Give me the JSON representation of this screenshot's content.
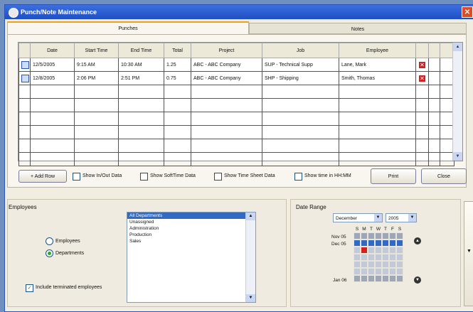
{
  "window": {
    "title": "Punch/Note Maintenance"
  },
  "tabs": [
    {
      "label": "Punches"
    },
    {
      "label": "Notes"
    }
  ],
  "grid": {
    "columns": [
      "Date",
      "Start Time",
      "End Time",
      "Total",
      "Project",
      "Job",
      "Employee"
    ],
    "rows": [
      {
        "date": "12/5/2005",
        "start": "9:15 AM",
        "end": "10:30 AM",
        "total": "1.25",
        "project": "ABC - ABC Company",
        "job": "SUP - Technical Supp",
        "employee": "Lane, Mark"
      },
      {
        "date": "12/8/2005",
        "start": "2:06 PM",
        "end": "2:51 PM",
        "total": "0.75",
        "project": "ABC - ABC Company",
        "job": "SHP - Shipping",
        "employee": "Smith, Thomas"
      }
    ]
  },
  "toolbar": {
    "add_row": "Add Row",
    "show_inout": "Show In/Out Data",
    "show_soft": "Show SoftTime Data",
    "show_timesheet": "Show Time Sheet Data",
    "show_hhmm": "Show time in HH:MM",
    "print": "Print",
    "close": "Close"
  },
  "employees": {
    "title": "Employees",
    "radio_employees": "Employees",
    "radio_departments": "Departments",
    "selected_radio": "Departments",
    "list": [
      "All Departments",
      "Unassigned",
      "Administration",
      "Production",
      "Sales"
    ],
    "selected_item": "All Departments",
    "include_terminated": "Include terminated employees"
  },
  "date_range": {
    "title": "Date Range",
    "month": "December",
    "year": "2005",
    "weekday_labels": [
      "S",
      "M",
      "T",
      "W",
      "T",
      "F",
      "S"
    ],
    "week_label_1": "Nov 05",
    "week_label_2": "Dec 05",
    "week_label_3": "Jan 06"
  },
  "colors": {
    "accent": "#316ac5",
    "titlebar": "#1e4fc4",
    "delete": "#d81e1e"
  }
}
